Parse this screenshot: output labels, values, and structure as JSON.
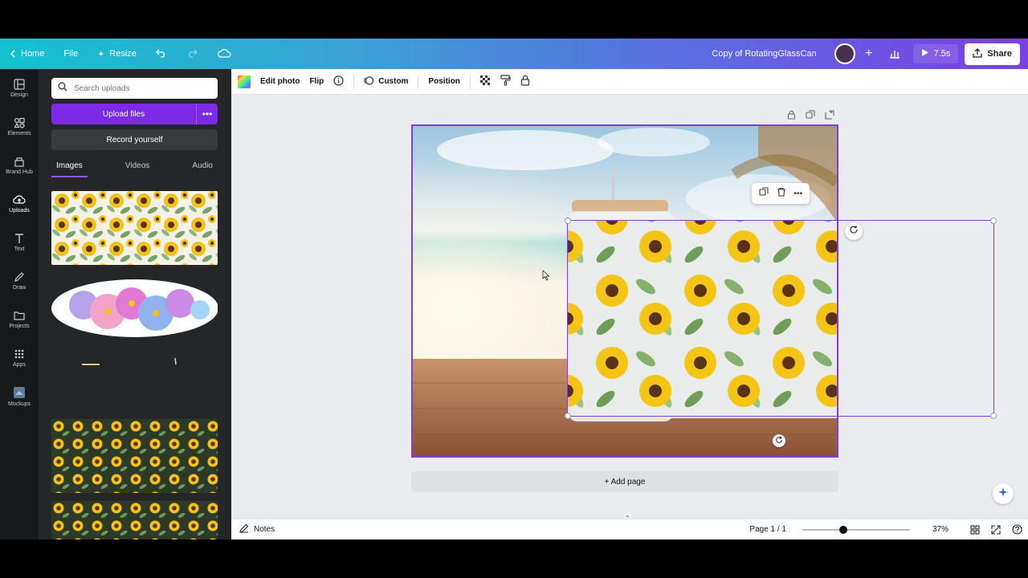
{
  "topbar": {
    "home": "Home",
    "file": "File",
    "resize": "Resize",
    "doc_title": "Copy of RotatingGlassCan",
    "present_duration": "7.5s",
    "share": "Share"
  },
  "rail": [
    {
      "label": "Design",
      "icon": "layout-icon"
    },
    {
      "label": "Elements",
      "icon": "shapes-icon"
    },
    {
      "label": "Brand Hub",
      "icon": "brand-icon"
    },
    {
      "label": "Uploads",
      "icon": "cloud-upload-icon"
    },
    {
      "label": "Text",
      "icon": "text-icon"
    },
    {
      "label": "Draw",
      "icon": "pen-icon"
    },
    {
      "label": "Projects",
      "icon": "folder-icon"
    },
    {
      "label": "Apps",
      "icon": "grid-icon"
    },
    {
      "label": "Mockups",
      "icon": "mockups-icon"
    }
  ],
  "panel": {
    "search_placeholder": "Search uploads",
    "upload_files": "Upload files",
    "record_yourself": "Record yourself",
    "tabs": [
      "Images",
      "Videos",
      "Audio"
    ]
  },
  "toolbar": {
    "edit_photo": "Edit photo",
    "flip": "Flip",
    "custom": "Custom",
    "position": "Position"
  },
  "canvas": {
    "add_page": "+ Add page"
  },
  "bottombar": {
    "notes": "Notes",
    "page_indicator": "Page 1 / 1",
    "zoom": "37%",
    "zoom_level": 0.37
  },
  "colors": {
    "accent": "#7d2ae8",
    "selection": "#7d3fd6",
    "panel_bg": "#252627",
    "rail_bg": "#18191b"
  }
}
